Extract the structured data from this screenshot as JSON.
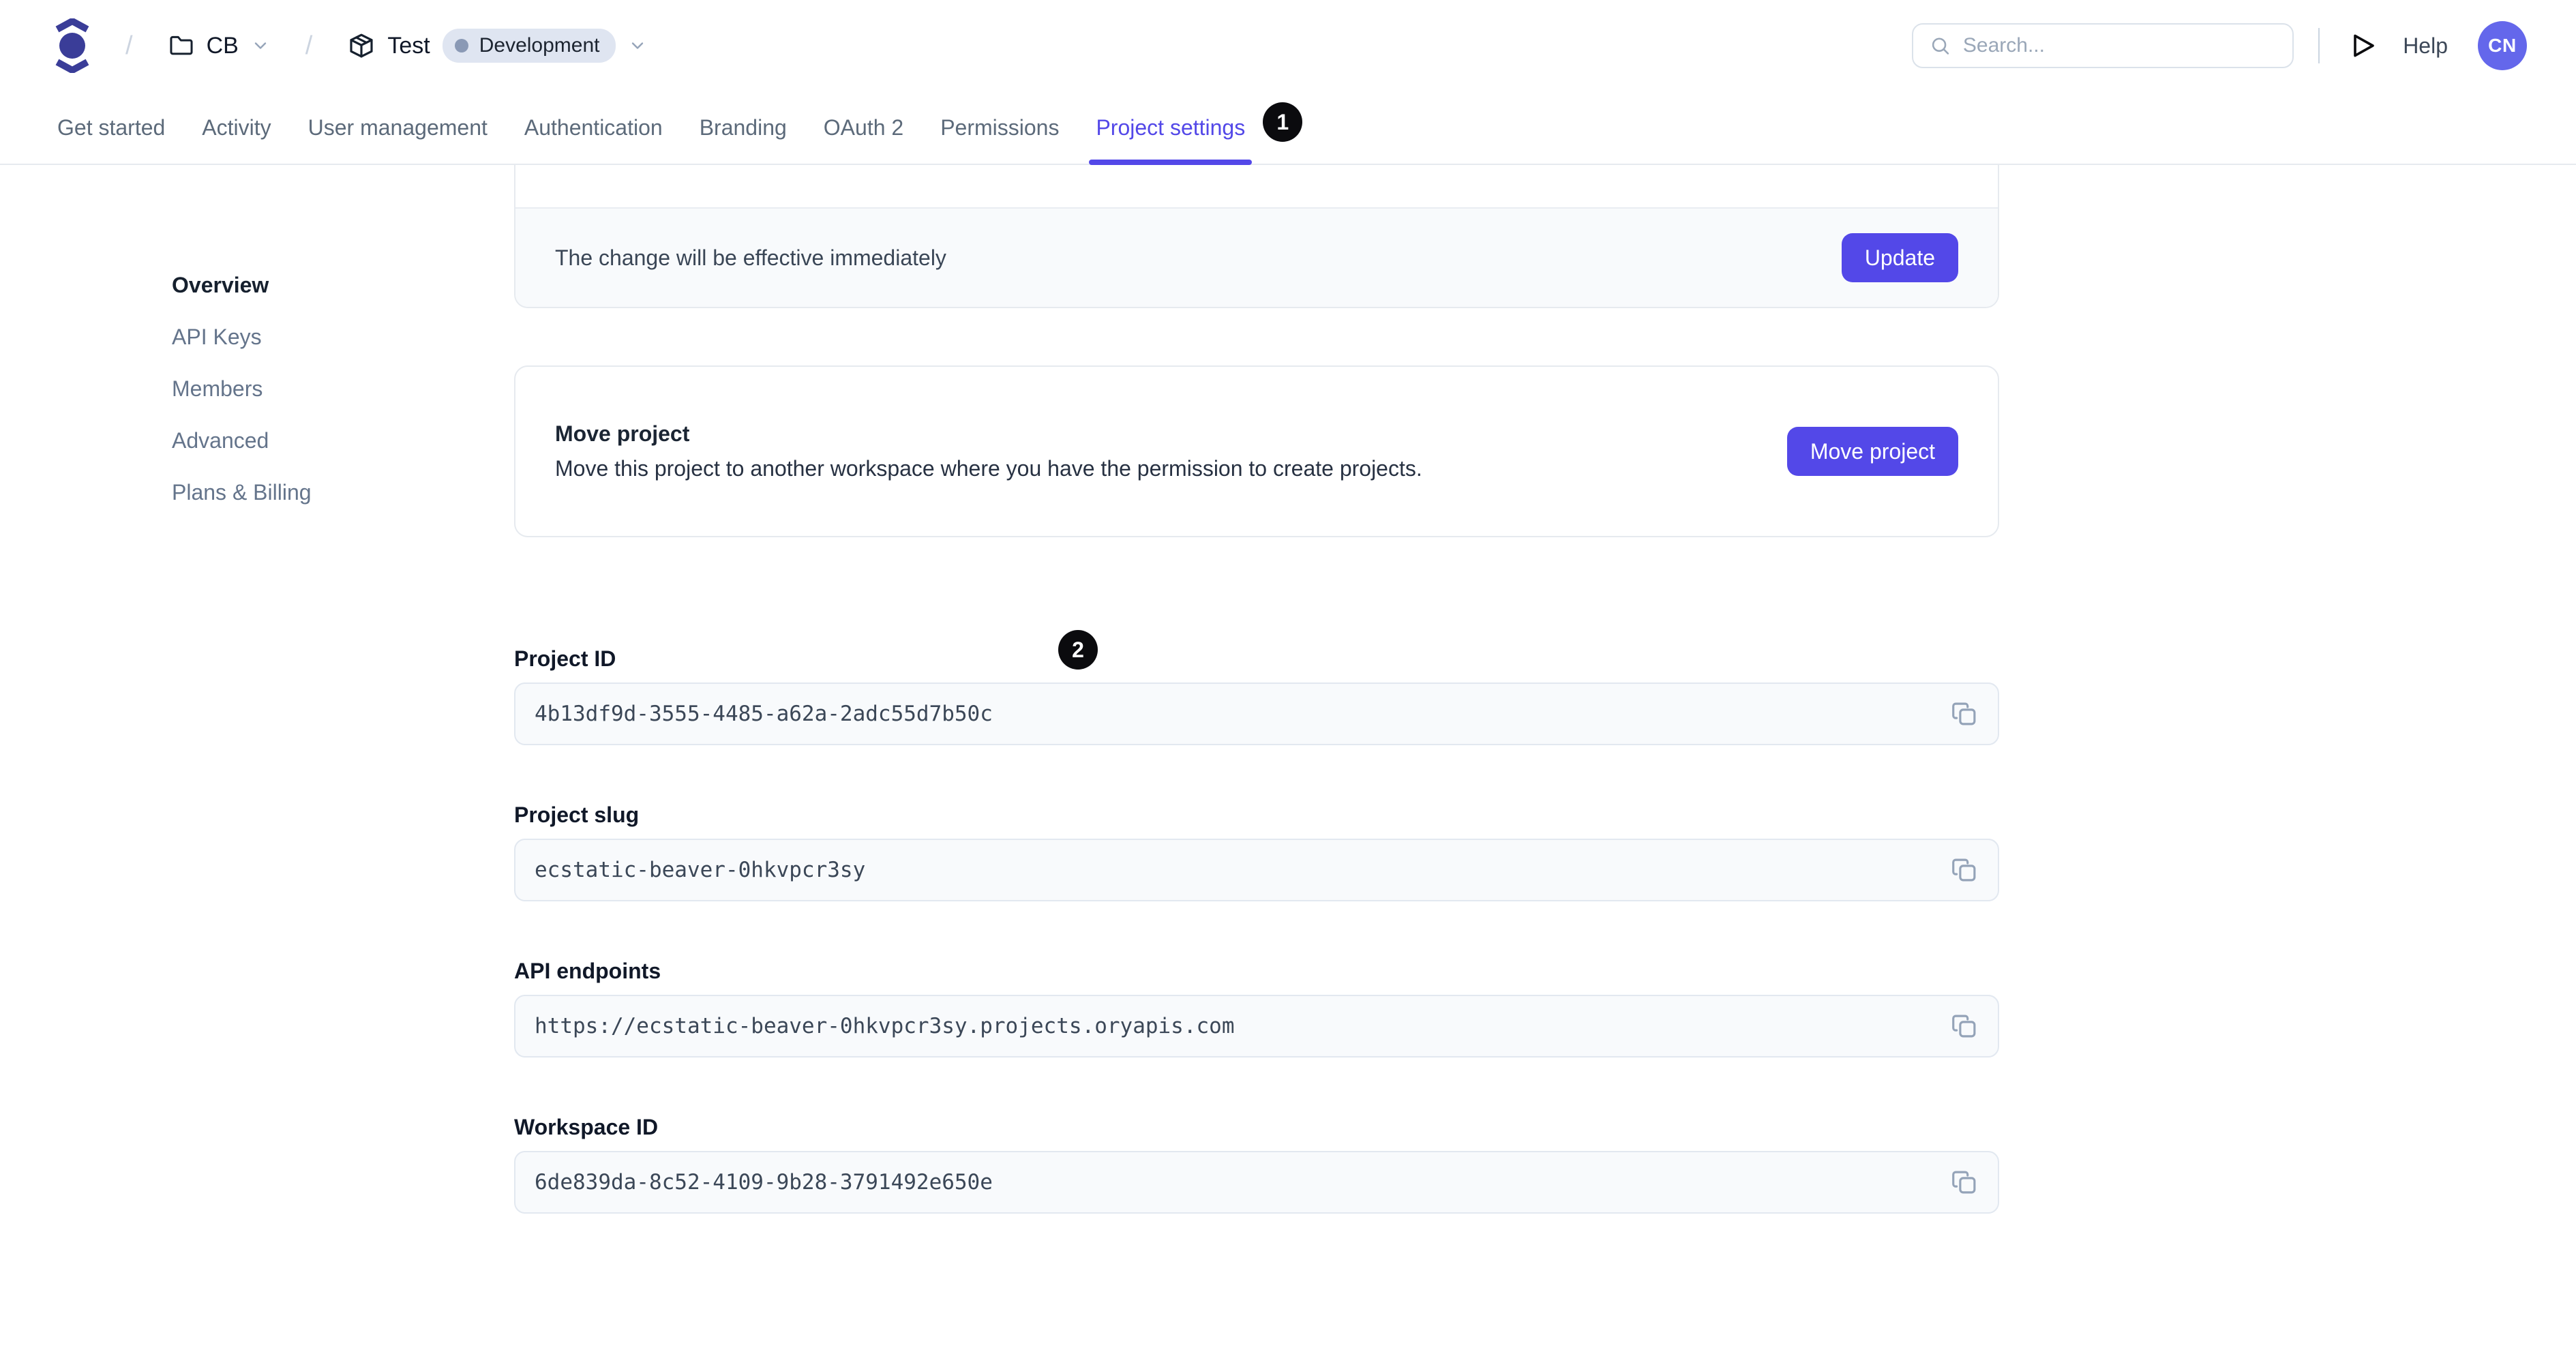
{
  "header": {
    "separator": "/",
    "workspace": {
      "label": "CB"
    },
    "project": {
      "label": "Test",
      "env_badge": "Development"
    },
    "search": {
      "placeholder": "Search..."
    },
    "help_label": "Help",
    "avatar_initials": "CN"
  },
  "tabs": [
    {
      "label": "Get started",
      "active": false
    },
    {
      "label": "Activity",
      "active": false
    },
    {
      "label": "User management",
      "active": false
    },
    {
      "label": "Authentication",
      "active": false
    },
    {
      "label": "Branding",
      "active": false
    },
    {
      "label": "OAuth 2",
      "active": false
    },
    {
      "label": "Permissions",
      "active": false
    },
    {
      "label": "Project settings",
      "active": true,
      "badge": "1"
    }
  ],
  "sidebar": [
    {
      "label": "Overview",
      "active": true
    },
    {
      "label": "API Keys",
      "active": false
    },
    {
      "label": "Members",
      "active": false
    },
    {
      "label": "Advanced",
      "active": false
    },
    {
      "label": "Plans & Billing",
      "active": false
    }
  ],
  "update_card": {
    "message": "The change will be effective immediately",
    "button": "Update"
  },
  "move_card": {
    "title": "Move project",
    "description": "Move this project to another workspace where you have the permission to create projects.",
    "button": "Move project"
  },
  "fields": [
    {
      "label": "Project ID",
      "value": "4b13df9d-3555-4485-a62a-2adc55d7b50c"
    },
    {
      "label": "Project slug",
      "value": "ecstatic-beaver-0hkvpcr3sy"
    },
    {
      "label": "API endpoints",
      "value": "https://ecstatic-beaver-0hkvpcr3sy.projects.oryapis.com"
    },
    {
      "label": "Workspace ID",
      "value": "6de839da-8c52-4109-9b28-3791492e650e"
    }
  ],
  "annotations": {
    "step1": "1",
    "step2": "2"
  },
  "colors": {
    "accent": "#5348E8",
    "logo": "#3A3D98",
    "avatar_bg": "#6467EB",
    "badge_bg": "#DFE5F1",
    "badge_dot": "#8A99B5",
    "field_bg": "#F8FAFC",
    "border": "#E6EAEF",
    "annotation_bg": "#0B0B0E"
  }
}
